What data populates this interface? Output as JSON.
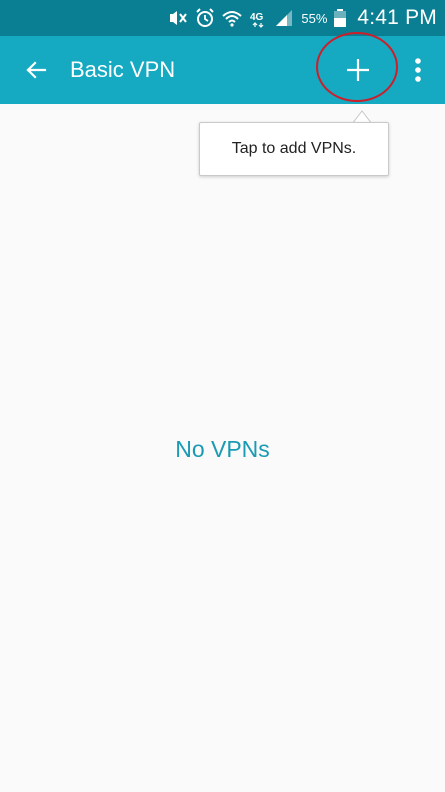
{
  "status_bar": {
    "battery_percent": "55%",
    "time": "4:41 PM",
    "network_label": "4G",
    "icons": [
      "mute-icon",
      "alarm-icon",
      "wifi-icon",
      "network-4g-icon",
      "signal-icon",
      "battery-icon"
    ]
  },
  "app_bar": {
    "title": "Basic VPN",
    "back_icon": "back-arrow-icon",
    "add_icon": "plus-icon",
    "overflow_icon": "more-vert-icon"
  },
  "tooltip": {
    "text": "Tap to add VPNs."
  },
  "main": {
    "empty_message": "No VPNs"
  },
  "colors": {
    "status_bar_bg": "#0a7f93",
    "app_bar_bg": "#15a9c2",
    "accent_text": "#1a9bb3",
    "highlight_ring": "#cc1f2a",
    "background": "#fafafa"
  }
}
